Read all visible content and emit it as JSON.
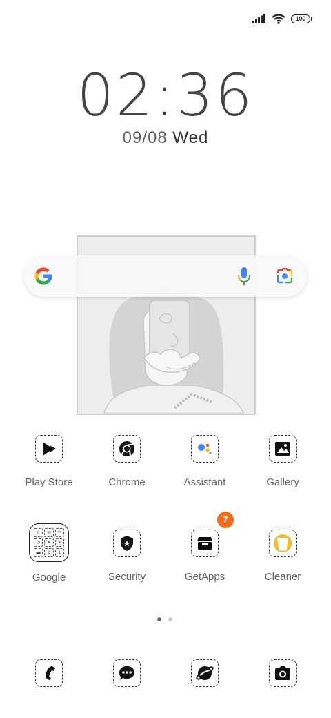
{
  "status_bar": {
    "battery": "100"
  },
  "lock": {
    "time": "02:36",
    "date": "09/08",
    "weekday": "Wed"
  },
  "search_bar": {
    "brand_colors": [
      "#4285F4",
      "#EA4335",
      "#FBBC05",
      "#34A853"
    ]
  },
  "apps_row1": [
    {
      "label": "Play Store",
      "icon": "play-store-icon"
    },
    {
      "label": "Chrome",
      "icon": "chrome-icon"
    },
    {
      "label": "Assistant",
      "icon": "assistant-icon"
    },
    {
      "label": "Gallery",
      "icon": "gallery-icon"
    }
  ],
  "apps_row2": [
    {
      "label": "Google",
      "icon": "google-folder-icon"
    },
    {
      "label": "Security",
      "icon": "security-icon"
    },
    {
      "label": "GetApps",
      "icon": "getapps-icon",
      "badge": "7"
    },
    {
      "label": "Cleaner",
      "icon": "cleaner-icon"
    }
  ],
  "dock": [
    {
      "icon": "phone-icon"
    },
    {
      "icon": "messages-icon"
    },
    {
      "icon": "browser-icon"
    },
    {
      "icon": "camera-icon"
    }
  ],
  "pages": {
    "count": 2,
    "current": 1
  },
  "colors": {
    "badge": "#f26a1b",
    "cleaner": "#f5b82e"
  }
}
